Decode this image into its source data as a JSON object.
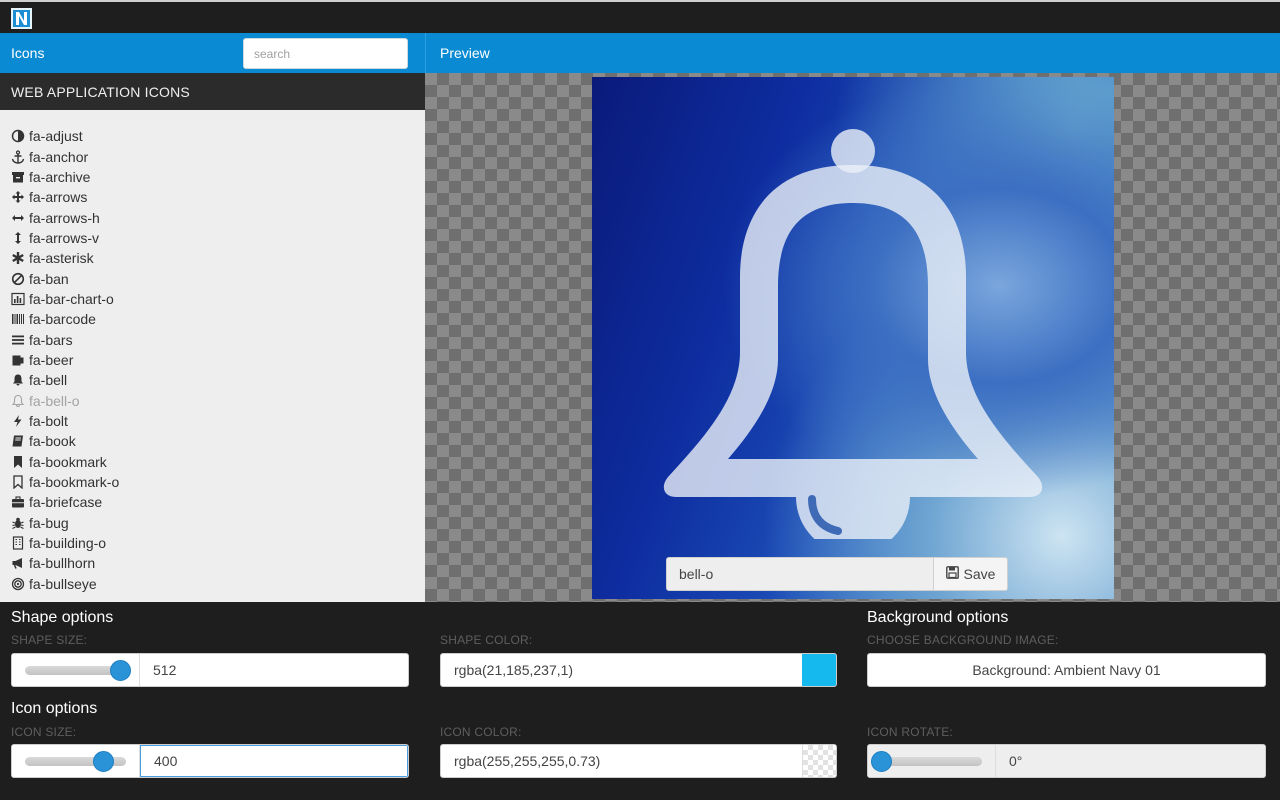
{
  "sidebar": {
    "title": "Icons",
    "search_placeholder": "search",
    "section_title": "WEB APPLICATION ICONS",
    "items": [
      {
        "label": "fa-adjust",
        "icon": "adjust-icon"
      },
      {
        "label": "fa-anchor",
        "icon": "anchor-icon"
      },
      {
        "label": "fa-archive",
        "icon": "archive-icon"
      },
      {
        "label": "fa-arrows",
        "icon": "arrows-icon"
      },
      {
        "label": "fa-arrows-h",
        "icon": "arrows-h-icon"
      },
      {
        "label": "fa-arrows-v",
        "icon": "arrows-v-icon"
      },
      {
        "label": "fa-asterisk",
        "icon": "asterisk-icon"
      },
      {
        "label": "fa-ban",
        "icon": "ban-icon"
      },
      {
        "label": "fa-bar-chart-o",
        "icon": "bar-chart-icon"
      },
      {
        "label": "fa-barcode",
        "icon": "barcode-icon"
      },
      {
        "label": "fa-bars",
        "icon": "bars-icon"
      },
      {
        "label": "fa-beer",
        "icon": "beer-icon"
      },
      {
        "label": "fa-bell",
        "icon": "bell-icon"
      },
      {
        "label": "fa-bell-o",
        "icon": "bell-outline-icon",
        "selected": true
      },
      {
        "label": "fa-bolt",
        "icon": "bolt-icon"
      },
      {
        "label": "fa-book",
        "icon": "book-icon"
      },
      {
        "label": "fa-bookmark",
        "icon": "bookmark-icon"
      },
      {
        "label": "fa-bookmark-o",
        "icon": "bookmark-outline-icon"
      },
      {
        "label": "fa-briefcase",
        "icon": "briefcase-icon"
      },
      {
        "label": "fa-bug",
        "icon": "bug-icon"
      },
      {
        "label": "fa-building-o",
        "icon": "building-icon"
      },
      {
        "label": "fa-bullhorn",
        "icon": "bullhorn-icon"
      },
      {
        "label": "fa-bullseye",
        "icon": "bullseye-icon"
      }
    ]
  },
  "preview": {
    "title": "Preview",
    "icon_name": "bell-o",
    "save_label": "Save",
    "background_name": "Ambient Navy 01"
  },
  "shape_options": {
    "title": "Shape options",
    "size_label": "SHAPE SIZE:",
    "size_value": "512",
    "size_fraction": 0.95,
    "color_label": "SHAPE COLOR:",
    "color_value": "rgba(21,185,237,1)",
    "color_swatch": "#15b9ed"
  },
  "background_options": {
    "title": "Background options",
    "image_label": "CHOOSE BACKGROUND IMAGE:",
    "image_button": "Background: Ambient Navy 01"
  },
  "icon_options": {
    "title": "Icon options",
    "size_label": "ICON SIZE:",
    "size_value": "400",
    "size_fraction": 0.78,
    "color_label": "ICON COLOR:",
    "color_value": "rgba(255,255,255,0.73)",
    "rotate_label": "ICON ROTATE:",
    "rotate_value": "0°",
    "rotate_fraction": 0.0
  },
  "colors": {
    "accent": "#0a8ad3",
    "knob": "#2a93d8",
    "shape_color": "#15b9ed"
  }
}
